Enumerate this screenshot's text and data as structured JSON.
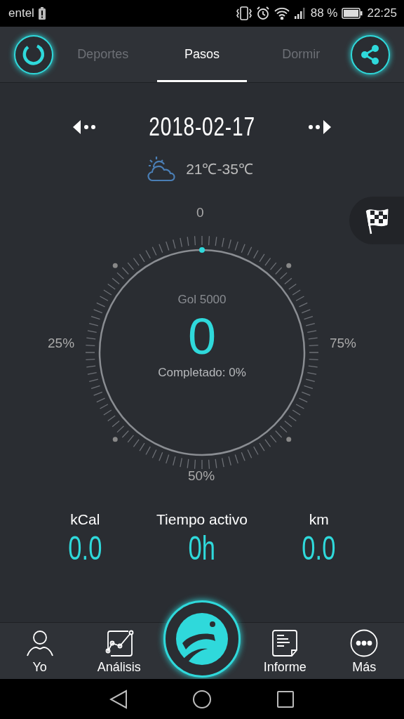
{
  "status_bar": {
    "carrier": "entel",
    "battery_percent": "88 %",
    "time": "22:25"
  },
  "tabs": [
    {
      "label": "Deportes",
      "selected": false
    },
    {
      "label": "Pasos",
      "selected": true
    },
    {
      "label": "Dormir",
      "selected": false
    }
  ],
  "date": "2018-02-17",
  "weather": {
    "range": "21℃-35℃"
  },
  "gauge": {
    "top_label": "0",
    "left_label": "25%",
    "right_label": "75%",
    "bottom_label": "50%",
    "goal": "Gol 5000",
    "value": "0",
    "completed": "Completado: 0%"
  },
  "stats": [
    {
      "label": "kCal",
      "value": "0.0"
    },
    {
      "label": "Tiempo activo",
      "value": "0h"
    },
    {
      "label": "km",
      "value": "0.0"
    }
  ],
  "bottom_nav": [
    {
      "label": "Yo",
      "kind": "person"
    },
    {
      "label": "Análisis",
      "kind": "chart"
    },
    {
      "kind": "center"
    },
    {
      "label": "Informe",
      "kind": "report"
    },
    {
      "label": "Más",
      "kind": "more"
    }
  ]
}
